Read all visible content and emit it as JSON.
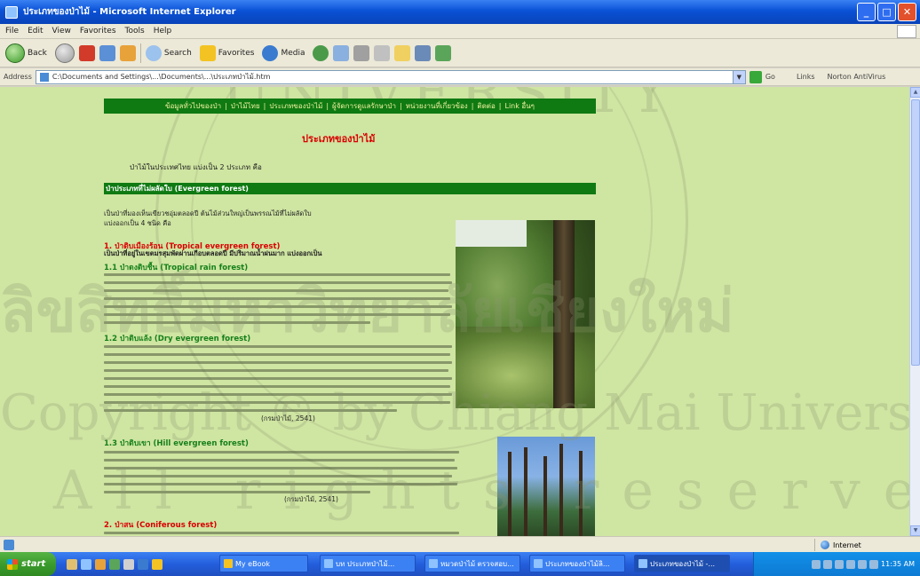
{
  "window": {
    "title": "ประเภทของป่าไม้ - Microsoft Internet Explorer",
    "buttons": [
      "_",
      "□",
      "✕"
    ]
  },
  "menu": [
    "File",
    "Edit",
    "View",
    "Favorites",
    "Tools",
    "Help"
  ],
  "toolbar": {
    "back": "Back",
    "search": "Search",
    "favorites": "Favorites",
    "media": "Media"
  },
  "address": {
    "label": "Address",
    "url": "C:\\Documents and Settings\\...\\Documents\\...\\ประเภทป่าไม้.htm",
    "go": "Go",
    "links": "Links",
    "norton": "Norton AntiVirus"
  },
  "page": {
    "nav_items": [
      "ข้อมูลทั่วไปของป่า",
      "ป่าไม้ไทย",
      "ประเภทของป่าไม้",
      "ผู้จัดการดูแลรักษาป่า",
      "หน่วยงานที่เกี่ยวข้อง",
      "ติดต่อ",
      "Link อื่นๆ"
    ],
    "heading": "ประเภทของป่าไม้",
    "intro": "ป่าไม้ในประเทศไทย แบ่งเป็น 2 ประเภท คือ",
    "section_title": "ป่าประเภทที่ไม่ผลัดใบ (Evergreen forest)",
    "section_intro_1": "เป็นป่าที่มองเห็นเขียวชอุ่มตลอดปี ต้นไม้ส่วนใหญ่เป็นพรรณไม้ที่ไม่ผลัดใบ",
    "section_intro_2": "แบ่งออกเป็น 4 ชนิด คือ",
    "sub1_title": "1. ป่าดิบเมืองร้อน (Tropical evergreen forest)",
    "sub1_desc": "เป็นป่าที่อยู่ในเขตมรสุมพัดผ่านเกือบตลอดปี มีปริมาณน้ำฝนมาก แบ่งออกเป็น",
    "sub11_title": "1.1 ป่าดงดิบชื้น (Tropical rain forest)",
    "sub12_title": "1.2 ป่าดิบแล้ง (Dry evergreen forest)",
    "sub12_ref": "(กรมป่าไม้, 2541)",
    "sub13_title": "1.3 ป่าดิบเขา (Hill evergreen forest)",
    "sub13_ref": "(กรมป่าไม้, 2541)",
    "sub2_title": "2. ป่าสน (Coniferous forest)"
  },
  "watermark": {
    "univ_top": "UNIVERSITY",
    "thai": "ลิขสิทธิ์มหาวิทยาลัยเชียงใหม่",
    "copyright": "Copyright © by Chiang Mai University",
    "reserved": "All rights reserved"
  },
  "status": {
    "zone": "Internet"
  },
  "taskbar": {
    "start": "start",
    "tasks": [
      "My eBook",
      "บท ประเภทป่าไม้...",
      "หมวดป่าไม้ ตรวจสอบ...",
      "ประเภทของป่าไม้ลิ...",
      "ประเภทของป่าไม้ -..."
    ],
    "clock": "11:35 AM"
  }
}
